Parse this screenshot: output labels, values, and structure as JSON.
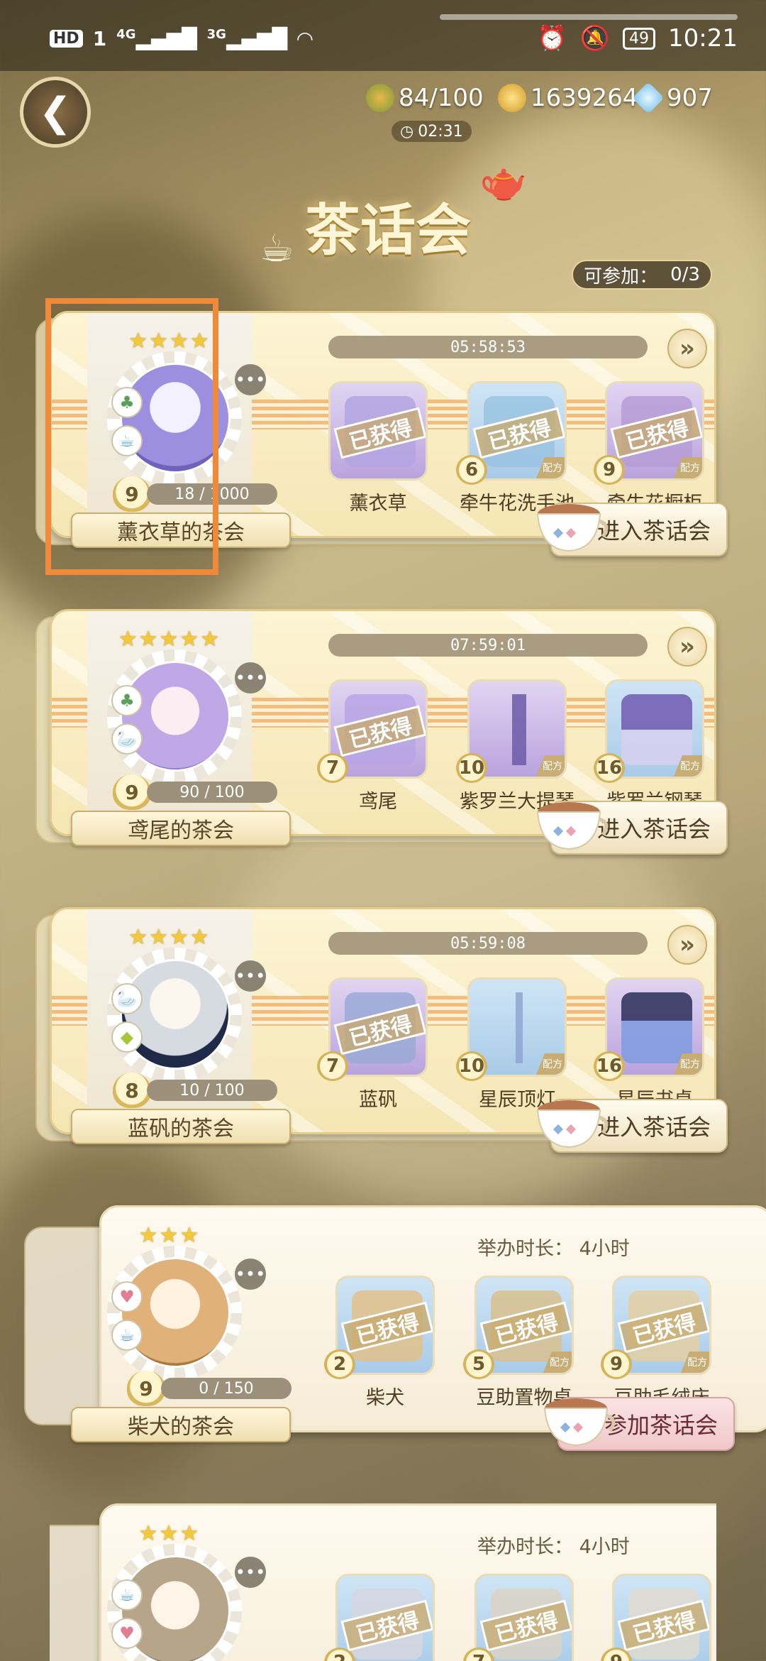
{
  "statusbar": {
    "left_icons": [
      "HD",
      "1",
      "4G",
      "3G",
      "wifi-icon"
    ],
    "battery": "49",
    "time": "10:21"
  },
  "header": {
    "stamina": "84/100",
    "coins": "1639264",
    "gems": "907",
    "refresh_timer": "02:31"
  },
  "title": "茶话会",
  "available": {
    "label": "可参加：",
    "value": "0/3"
  },
  "obtained_label": "已获得",
  "recipe_label": "配方",
  "cards": [
    {
      "timer": "05:58:53",
      "level": "9",
      "progress": "18 / 1000",
      "name": "薰衣草的茶会",
      "button": "进入茶话会",
      "items": [
        {
          "num": "",
          "name": "薰衣草",
          "obtained": true
        },
        {
          "num": "6",
          "name": "牵牛花洗手池",
          "obtained": true
        },
        {
          "num": "9",
          "name": "牵牛花橱柜",
          "obtained": true
        }
      ]
    },
    {
      "timer": "07:59:01",
      "level": "9",
      "progress": "90 / 100",
      "name": "鸢尾的茶会",
      "button": "进入茶话会",
      "items": [
        {
          "num": "7",
          "name": "鸢尾",
          "obtained": true
        },
        {
          "num": "10",
          "name": "紫罗兰大提琴",
          "obtained": false
        },
        {
          "num": "16",
          "name": "紫罗兰钢琴",
          "obtained": false
        }
      ]
    },
    {
      "timer": "05:59:08",
      "level": "8",
      "progress": "10 / 100",
      "name": "蓝矾的茶会",
      "button": "进入茶话会",
      "items": [
        {
          "num": "7",
          "name": "蓝矾",
          "obtained": true
        },
        {
          "num": "10",
          "name": "星辰顶灯",
          "obtained": false
        },
        {
          "num": "16",
          "name": "星辰书桌",
          "obtained": false
        }
      ]
    },
    {
      "duration": "举办时长： 4小时",
      "level": "9",
      "progress": "0 / 150",
      "name": "柴犬的茶会",
      "button": "参加茶话会",
      "items": [
        {
          "num": "2",
          "name": "柴犬",
          "obtained": true
        },
        {
          "num": "5",
          "name": "豆助置物桌",
          "obtained": true
        },
        {
          "num": "9",
          "name": "豆助毛绒床",
          "obtained": true
        }
      ]
    },
    {
      "duration": "举办时长： 4小时",
      "items": [
        {
          "num": "2",
          "obtained": true
        },
        {
          "num": "7",
          "obtained": true
        },
        {
          "num": "9",
          "obtained": true
        }
      ]
    }
  ],
  "colors": {
    "accent_orange": "#f08a3b",
    "gold": "#f3c83a",
    "panel": "#f5e6b4"
  }
}
